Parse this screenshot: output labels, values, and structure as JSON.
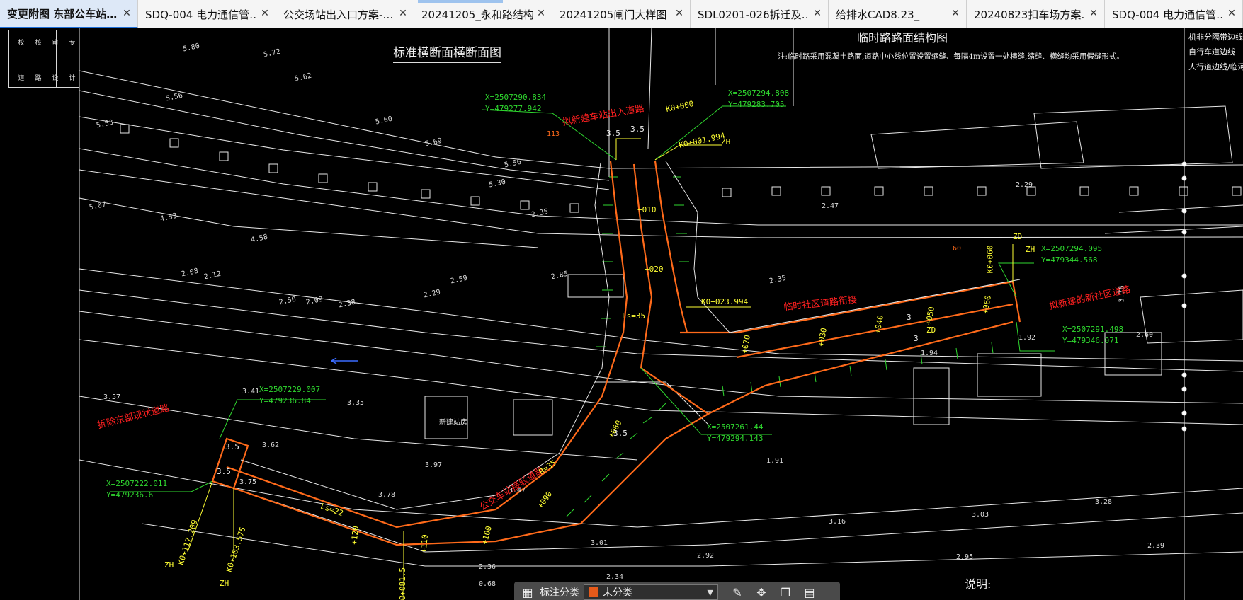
{
  "tabs": [
    {
      "label": "变更附图 东部公车站…",
      "active": true
    },
    {
      "label": "SDQ-004 电力通信管…",
      "active": false
    },
    {
      "label": "公交场站出入口方案-…",
      "active": false
    },
    {
      "label": "20241205_永和路结构…",
      "active": false
    },
    {
      "label": "20241205闸门大样图",
      "active": false
    },
    {
      "label": "SDL0201-026拆迁及…",
      "active": false
    },
    {
      "label": "给排水CAD8.23_",
      "active": false
    },
    {
      "label": "20240823扣车场方案…",
      "active": false
    },
    {
      "label": "SDQ-004 电力通信管…",
      "active": false
    }
  ],
  "tab_close_glyph": "✕",
  "drawing": {
    "title_left": "标准横断面横断面图",
    "title_right": "临时路路面结构图",
    "note_top": "注:临时路采用混凝土路面,道路中心线位置设置缩缝、每隔4m设置一处横缝,缩缝、横缝均采用假缝形式。",
    "note_bottom": "说明:",
    "legend_right": [
      "机非分隔带边线",
      "自行车道边线",
      "人行道边线/临河景观线"
    ],
    "left_panel_chars": [
      "校",
      "核",
      "审",
      "专",
      "道",
      "路",
      "设",
      "计"
    ],
    "red_labels": [
      "拟新建车站出入道路",
      "临时社区道路衔接",
      "拟新建的新社区道路",
      "拆除东部现状道路",
      "公交车站接驳道路"
    ],
    "stations": [
      "K0+000",
      "K0+001.994",
      "K0+023.994",
      "K0+060",
      "K0+117.209",
      "K0+103.575",
      "K0+081.5",
      "ZH",
      "ZH",
      "ZH",
      "ZH",
      "ZD",
      "ZD",
      "+010",
      "+020",
      "+030",
      "+040",
      "+050",
      "+060",
      "+070",
      "+080",
      "+090",
      "+100",
      "+110",
      "+120"
    ],
    "coords": [
      {
        "x": "X=2507290.834",
        "y": "Y=479277.942"
      },
      {
        "x": "X=2507294.808",
        "y": "Y=479283.705"
      },
      {
        "x": "X=2507294.095",
        "y": "Y=479344.568"
      },
      {
        "x": "X=2507291.498",
        "y": "Y=479346.071"
      },
      {
        "x": "X=2507229.007",
        "y": "Y=479236.84"
      },
      {
        "x": "X=2507261.44",
        "y": "Y=479294.143"
      },
      {
        "x": "X=2507222.011",
        "y": "Y=479236.6"
      }
    ],
    "dims": [
      "3.5",
      "3.5",
      "3.5",
      "3.5",
      "3",
      "3",
      "3.5",
      "Ls=35",
      "Ls=22",
      "R=35",
      "113",
      "60"
    ],
    "elevations": [
      "5.72",
      "5.62",
      "5.80",
      "5.56",
      "5.53",
      "5.60",
      "5.69",
      "5.56",
      "5.30",
      "2.35",
      "5.07",
      "4.53",
      "2.08",
      "2.12",
      "4.58",
      "2.50",
      "2.09",
      "2.38",
      "2.59",
      "2.29",
      "2.85",
      "2.35",
      "3.57",
      "3.41",
      "3.35",
      "3.62",
      "3.75",
      "3.97",
      "3.78",
      "3.47",
      "1.91",
      "3.01",
      "2.92",
      "2.36",
      "2.34",
      "3.16",
      "3.03",
      "2.95",
      "3.28",
      "2.39",
      "2.60",
      "2.47",
      "2.29",
      "1.94",
      "1.92",
      "3.76",
      "0.68"
    ],
    "building_label": "新建站房"
  },
  "toolbar": {
    "label": "标注分类",
    "selected": "未分类",
    "swatch_color": "#e65a1a"
  },
  "colors": {
    "road": "#ff6a1a",
    "leader": "#2fd82f",
    "annotation": "#ffff33",
    "line": "#e8e8e8",
    "red_text": "#ff2020"
  }
}
